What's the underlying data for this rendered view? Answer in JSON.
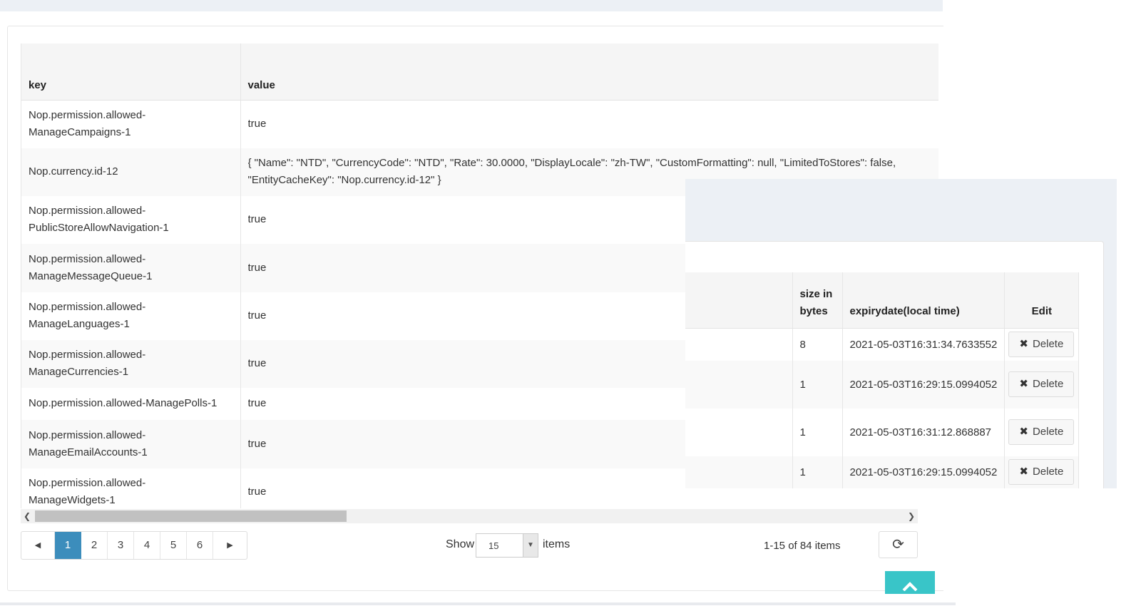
{
  "grid": {
    "columns": [
      "key",
      "value"
    ],
    "rows": [
      {
        "key": [
          "Nop.permission.allowed-",
          "ManageCampaigns-1"
        ],
        "value": [
          "true"
        ]
      },
      {
        "key": [
          "Nop.currency.id-12"
        ],
        "value": [
          "{ \"Name\": \"NTD\", \"CurrencyCode\": \"NTD\", \"Rate\": 30.0000, \"DisplayLocale\": \"zh-TW\", \"CustomFormatting\": null, \"LimitedToStores\": false,",
          "\"EntityCacheKey\": \"Nop.currency.id-12\" }"
        ]
      },
      {
        "key": [
          "Nop.permission.allowed-",
          "PublicStoreAllowNavigation-1"
        ],
        "value": [
          "true"
        ]
      },
      {
        "key": [
          "Nop.permission.allowed-",
          "ManageMessageQueue-1"
        ],
        "value": [
          "true"
        ]
      },
      {
        "key": [
          "Nop.permission.allowed-",
          "ManageLanguages-1"
        ],
        "value": [
          "true"
        ]
      },
      {
        "key": [
          "Nop.permission.allowed-",
          "ManageCurrencies-1"
        ],
        "value": [
          "true"
        ]
      },
      {
        "key": [
          "Nop.permission.allowed-ManagePolls-1"
        ],
        "value": [
          "true"
        ]
      },
      {
        "key": [
          "Nop.permission.allowed-",
          "ManageEmailAccounts-1"
        ],
        "value": [
          "true"
        ]
      },
      {
        "key": [
          "Nop.permission.allowed-",
          "ManageWidgets-1"
        ],
        "value": [
          "true"
        ]
      }
    ]
  },
  "pager": {
    "prev": "◀",
    "next": "▶",
    "pages": [
      "1",
      "2",
      "3",
      "4",
      "5",
      "6"
    ],
    "active": "1",
    "show_label": "Show",
    "page_size": "15",
    "items_label": "items",
    "count_text": "1-15 of 84 items",
    "refresh_icon": "⟳"
  },
  "overlay_grid": {
    "columns": [
      "size in bytes",
      "expirydate(local time)",
      "Edit"
    ],
    "rows": [
      {
        "size": "8",
        "expiry": "2021-05-03T16:31:34.7633552",
        "action": "Delete"
      },
      {
        "size": "1",
        "expiry": "2021-05-03T16:29:15.0994052",
        "action": "Delete"
      },
      {
        "size": "1",
        "expiry": "2021-05-03T16:31:12.868887",
        "action": "Delete"
      },
      {
        "size": "1",
        "expiry": "2021-05-03T16:29:15.0994052",
        "action": "Delete"
      }
    ]
  },
  "colors": {
    "accent": "#3c8dbc",
    "to_top": "#39c5c8",
    "header_bg": "#f5f5f5",
    "page_bg": "#ecf0f5"
  }
}
